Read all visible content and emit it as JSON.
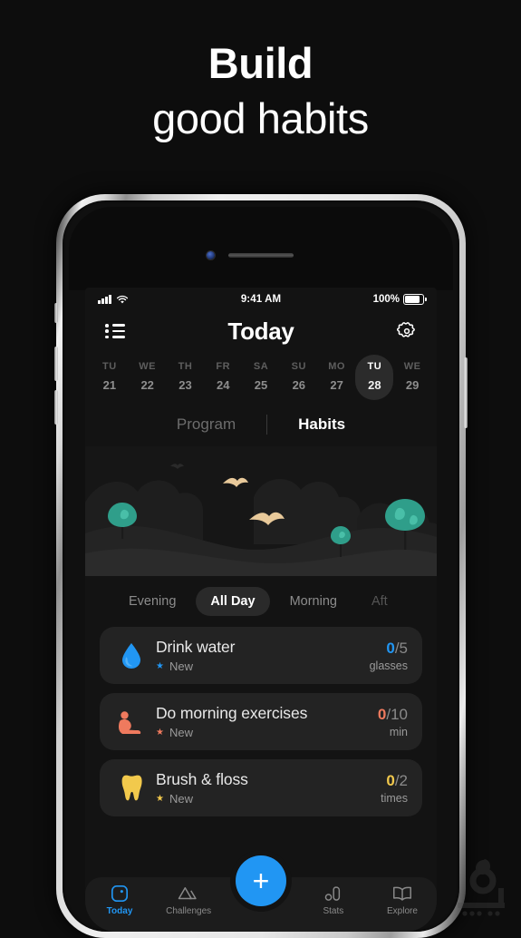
{
  "promo": {
    "line1": "Build",
    "line2": "good habits",
    "background": "#0d0d0d"
  },
  "status_bar": {
    "time": "9:41 AM",
    "battery_percent": "100%",
    "signal_icon": "cellular-signal-icon",
    "wifi_icon": "wifi-icon",
    "battery_icon": "battery-full-icon"
  },
  "nav": {
    "menu_icon": "list-menu-icon",
    "title": "Today",
    "settings_icon": "gear-icon"
  },
  "date_strip": {
    "days": [
      {
        "dow": "TU",
        "num": "21",
        "selected": false
      },
      {
        "dow": "WE",
        "num": "22",
        "selected": false
      },
      {
        "dow": "TH",
        "num": "23",
        "selected": false
      },
      {
        "dow": "FR",
        "num": "24",
        "selected": false
      },
      {
        "dow": "SA",
        "num": "25",
        "selected": false
      },
      {
        "dow": "SU",
        "num": "26",
        "selected": false
      },
      {
        "dow": "MO",
        "num": "27",
        "selected": false
      },
      {
        "dow": "TU",
        "num": "28",
        "selected": true
      },
      {
        "dow": "WE",
        "num": "29",
        "selected": false
      }
    ]
  },
  "segments": [
    {
      "label": "Program",
      "active": false
    },
    {
      "label": "Habits",
      "active": true
    }
  ],
  "illustration": {
    "name": "night-landscape-illustration",
    "sky": "#161616",
    "tree_color": "#2f9e8a",
    "bird_color": "#e8c99a"
  },
  "filter_pills": [
    {
      "label": "Evening",
      "active": false
    },
    {
      "label": "All Day",
      "active": true
    },
    {
      "label": "Morning",
      "active": false
    },
    {
      "label": "Aft",
      "active": false
    }
  ],
  "habits": [
    {
      "icon": "water-drop-icon",
      "title": "Drink water",
      "badge": "New",
      "done": "0",
      "goal": "/5",
      "unit": "glasses",
      "color": "#2196f3"
    },
    {
      "icon": "sit-up-exercise-icon",
      "title": "Do morning exercises",
      "badge": "New",
      "done": "0",
      "goal": "/10",
      "unit": "min",
      "color": "#ef7a5e"
    },
    {
      "icon": "tooth-icon",
      "title": "Brush & floss",
      "badge": "New",
      "done": "0",
      "goal": "/2",
      "unit": "times",
      "color": "#f2c94c"
    }
  ],
  "fab": {
    "label": "+",
    "name": "add-habit-button",
    "color": "#2196f3"
  },
  "tabbar": [
    {
      "label": "Today",
      "icon": "today-square-icon",
      "active": true
    },
    {
      "label": "Challenges",
      "icon": "mountains-icon",
      "active": false
    },
    {
      "label": "Stats",
      "icon": "bar-chart-icon",
      "active": false
    },
    {
      "label": "Explore",
      "icon": "open-book-icon",
      "active": false
    }
  ],
  "watermark": {
    "name": "site-watermark-logo"
  }
}
